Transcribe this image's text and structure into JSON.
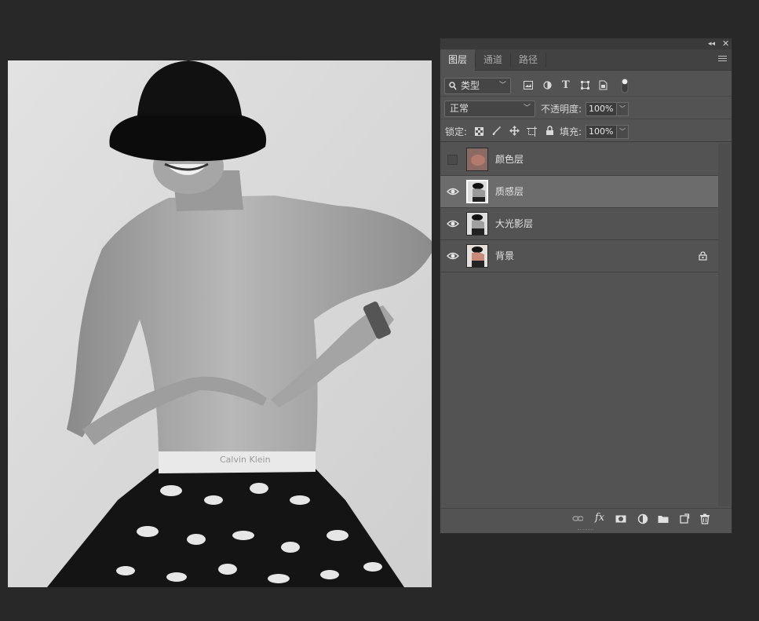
{
  "panel": {
    "tabs": [
      {
        "label": "图层",
        "active": true
      },
      {
        "label": "通道",
        "active": false
      },
      {
        "label": "路径",
        "active": false
      }
    ],
    "filter": {
      "label": "类型"
    },
    "blend_mode": "正常",
    "opacity_label": "不透明度:",
    "opacity_value": "100%",
    "lock_label": "锁定:",
    "fill_label": "填充:",
    "fill_value": "100%"
  },
  "layers": [
    {
      "name": "颜色层",
      "visible": false,
      "selected": false,
      "locked": false,
      "thumb": "color-swatch"
    },
    {
      "name": "质感层",
      "visible": true,
      "selected": true,
      "locked": false,
      "thumb": "grayscale-photo"
    },
    {
      "name": "大光影层",
      "visible": true,
      "selected": false,
      "locked": false,
      "thumb": "grayscale-photo"
    },
    {
      "name": "背景",
      "visible": true,
      "selected": false,
      "locked": true,
      "thumb": "color-photo"
    }
  ],
  "footer_icons": [
    "link-layers-icon",
    "fx-icon",
    "add-mask-icon",
    "adjustment-layer-icon",
    "new-group-icon",
    "new-layer-icon",
    "delete-layer-icon"
  ],
  "photo": {
    "waistband_text": "Calvin Klein"
  },
  "colors": {
    "panel_bg": "#535353",
    "selected_row": "#6c6c6c",
    "workspace_bg": "#282828",
    "color_layer_swatch": "#a9756a"
  }
}
